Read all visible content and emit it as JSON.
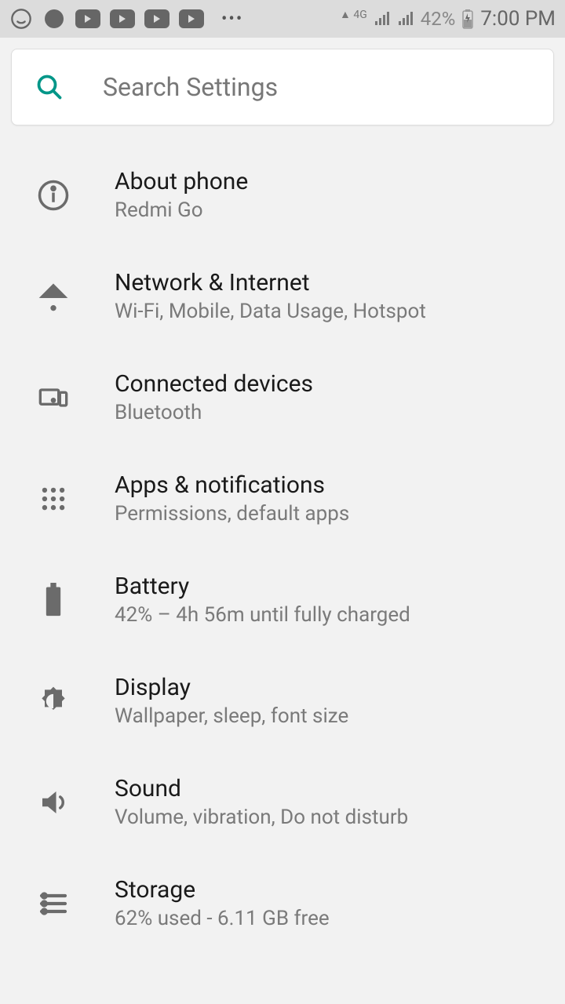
{
  "status": {
    "battery": "42%",
    "time": "7:00 PM",
    "network": "4G"
  },
  "search": {
    "placeholder": "Search Settings"
  },
  "items": [
    {
      "title": "About phone",
      "sub": "Redmi Go"
    },
    {
      "title": "Network & Internet",
      "sub": "Wi-Fi, Mobile, Data Usage, Hotspot"
    },
    {
      "title": "Connected devices",
      "sub": "Bluetooth"
    },
    {
      "title": "Apps & notifications",
      "sub": "Permissions, default apps"
    },
    {
      "title": "Battery",
      "sub": "42% – 4h 56m until fully charged"
    },
    {
      "title": "Display",
      "sub": "Wallpaper, sleep, font size"
    },
    {
      "title": "Sound",
      "sub": "Volume, vibration, Do not disturb"
    },
    {
      "title": "Storage",
      "sub": "62% used - 6.11 GB free"
    }
  ]
}
